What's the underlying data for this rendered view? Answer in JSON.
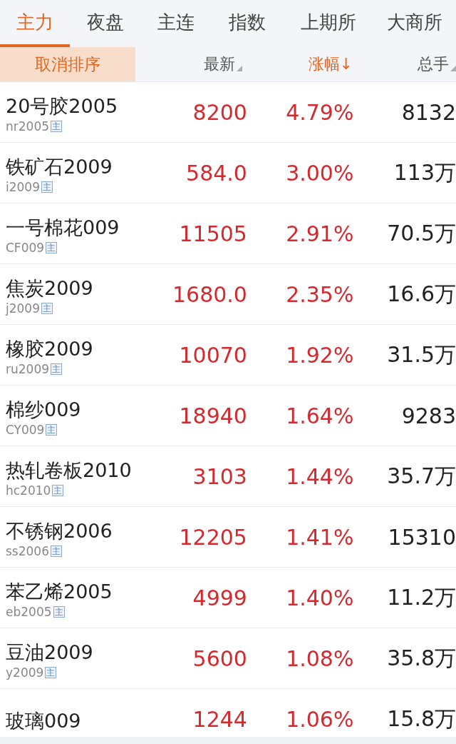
{
  "tabs": [
    {
      "label": "主力",
      "selected": true
    },
    {
      "label": "夜盘",
      "selected": false
    },
    {
      "label": "主连",
      "selected": false
    },
    {
      "label": "指数",
      "selected": false
    },
    {
      "label": "上期所",
      "selected": false
    },
    {
      "label": "大商所",
      "selected": false
    }
  ],
  "cancel_sort": "取消排序",
  "columns": [
    {
      "label": "最新",
      "selected": false
    },
    {
      "label": "涨幅↓",
      "selected": true
    },
    {
      "label": "总手",
      "selected": false
    }
  ],
  "rows": [
    {
      "name": "20号胶2005",
      "code": "nr2005",
      "badge": "主",
      "price": "8200",
      "change": "4.79%",
      "volume": "8132"
    },
    {
      "name": "铁矿石2009",
      "code": "i2009",
      "badge": "主",
      "price": "584.0",
      "change": "3.00%",
      "volume": "113万"
    },
    {
      "name": "一号棉花009",
      "code": "CF009",
      "badge": "主",
      "price": "11505",
      "change": "2.91%",
      "volume": "70.5万"
    },
    {
      "name": "焦炭2009",
      "code": "j2009",
      "badge": "主",
      "price": "1680.0",
      "change": "2.35%",
      "volume": "16.6万"
    },
    {
      "name": "橡胶2009",
      "code": "ru2009",
      "badge": "主",
      "price": "10070",
      "change": "1.92%",
      "volume": "31.5万"
    },
    {
      "name": "棉纱009",
      "code": "CY009",
      "badge": "主",
      "price": "18940",
      "change": "1.64%",
      "volume": "9283"
    },
    {
      "name": "热轧卷板2010",
      "code": "hc2010",
      "badge": "主",
      "price": "3103",
      "change": "1.44%",
      "volume": "35.7万"
    },
    {
      "name": "不锈钢2006",
      "code": "ss2006",
      "badge": "主",
      "price": "12205",
      "change": "1.41%",
      "volume": "15310"
    },
    {
      "name": "苯乙烯2005",
      "code": "eb2005",
      "badge": "主",
      "price": "4999",
      "change": "1.40%",
      "volume": "11.2万"
    },
    {
      "name": "豆油2009",
      "code": "y2009",
      "badge": "主",
      "price": "5600",
      "change": "1.08%",
      "volume": "35.8万"
    },
    {
      "name": "玻璃009",
      "price": "1244",
      "change": "1.06%",
      "volume": "15.8万"
    }
  ]
}
